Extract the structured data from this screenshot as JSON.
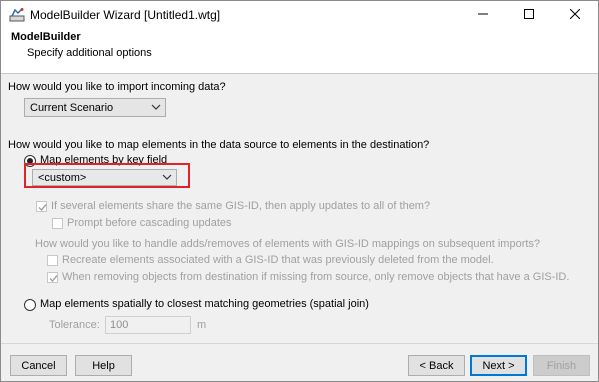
{
  "window": {
    "title": "ModelBuilder Wizard [Untitled1.wtg]",
    "controls": {
      "minimize": "minimize-icon",
      "maximize": "maximize-icon",
      "close": "close-icon"
    }
  },
  "header": {
    "title": "ModelBuilder",
    "subtitle": "Specify additional options"
  },
  "import": {
    "question": "How would you like to import incoming data?",
    "selected": "Current Scenario"
  },
  "mapping": {
    "question": "How would you like to map elements in the data source to elements in the destination?",
    "key_field_option": "Map elements by key field",
    "key_field_selected": "<custom>",
    "key_field_checked": true,
    "shared_gis_id": {
      "label": "If several elements share the same GIS-ID, then apply updates to all of them?",
      "checked": true
    },
    "prompt_cascade": {
      "label": "Prompt before cascading updates",
      "checked": false
    },
    "handle_question": "How would you like to handle adds/removes of elements with GIS-ID mappings on subsequent imports?",
    "recreate": {
      "label": "Recreate elements associated with a GIS-ID that was previously deleted from the model.",
      "checked": false
    },
    "remove_only": {
      "label": "When removing objects from destination if missing from source, only remove objects that have a GIS-ID.",
      "checked": true
    },
    "spatial_option": "Map elements spatially to closest matching geometries (spatial join)",
    "spatial_checked": false,
    "tolerance_label": "Tolerance:",
    "tolerance_value": "100",
    "tolerance_unit": "m"
  },
  "footer": {
    "cancel": "Cancel",
    "help": "Help",
    "back": "< Back",
    "next": "Next >",
    "finish": "Finish"
  },
  "colors": {
    "highlight": "#e0222b",
    "accent": "#0078d7"
  }
}
